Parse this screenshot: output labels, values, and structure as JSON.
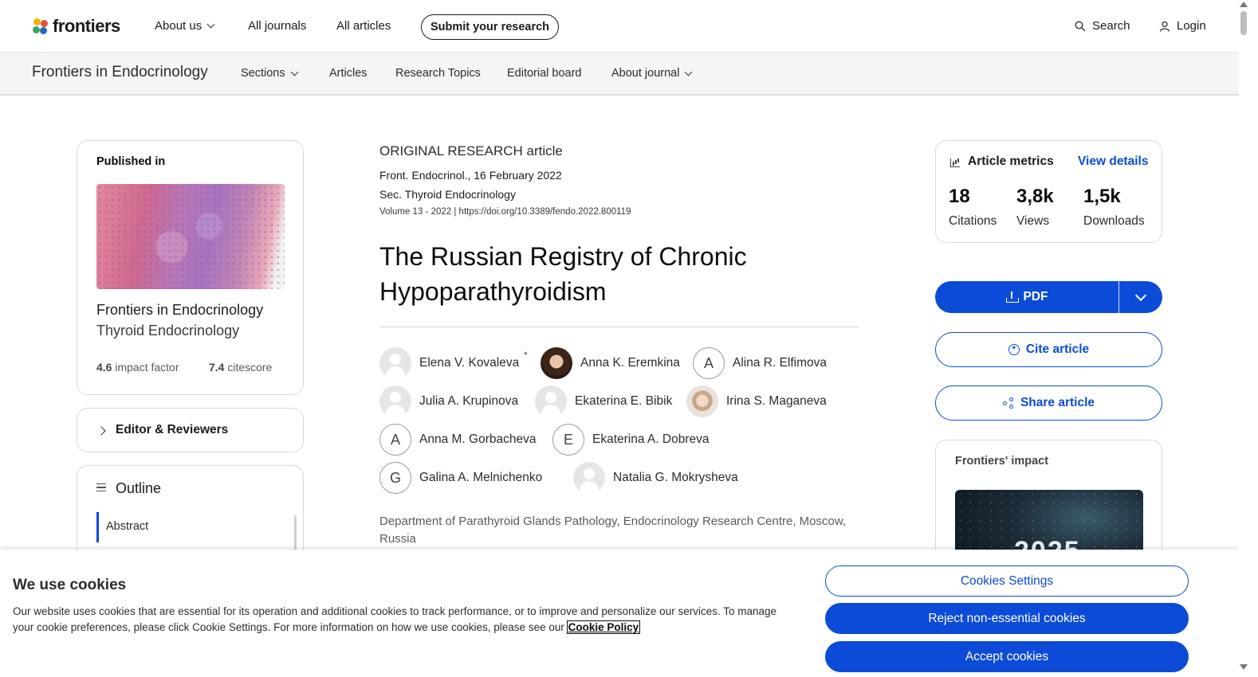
{
  "topnav": {
    "logo_text": "frontiers",
    "about_us": "About us",
    "all_journals": "All journals",
    "all_articles": "All articles",
    "submit": "Submit your research",
    "search": "Search",
    "login": "Login"
  },
  "journal_nav": {
    "title": "Frontiers in Endocrinology",
    "sections": "Sections",
    "articles": "Articles",
    "research_topics": "Research Topics",
    "editorial_board": "Editorial board",
    "about_journal": "About journal"
  },
  "published_in": {
    "label": "Published in",
    "journal": "Frontiers in Endocrinology",
    "section": "Thyroid Endocrinology",
    "impact_value": "4.6",
    "impact_label": "impact factor",
    "citescore_value": "7.4",
    "citescore_label": "citescore"
  },
  "editors": {
    "label": "Editor & Reviewers"
  },
  "outline": {
    "label": "Outline",
    "items": [
      "Abstract"
    ]
  },
  "article": {
    "type": "ORIGINAL RESEARCH article",
    "journal_date": "Front. Endocrinol., 16 February 2022",
    "section": "Sec. Thyroid Endocrinology",
    "volume": "Volume 13 - 2022 |",
    "doi": "https://doi.org/10.3389/fendo.2022.800119",
    "title": "The Russian Registry of Chronic Hypoparathyroidism",
    "authors": [
      {
        "name": "Elena V. Kovaleva",
        "sup": "*",
        "avatar": "ghost"
      },
      {
        "name": "Anna K. Eremkina",
        "avatar": "photo"
      },
      {
        "name": "Alina R. Elfimova",
        "avatar": "letter",
        "letter": "A"
      },
      {
        "name": "Julia A. Krupinova",
        "avatar": "ghost"
      },
      {
        "name": "Ekaterina E. Bibik",
        "avatar": "ghost"
      },
      {
        "name": "Irina S. Maganeva",
        "avatar": "photo"
      },
      {
        "name": "Anna M. Gorbacheva",
        "avatar": "letter",
        "letter": "A"
      },
      {
        "name": "Ekaterina A. Dobreva",
        "avatar": "letter",
        "letter": "E"
      },
      {
        "name": "Galina A. Melnichenko",
        "avatar": "letter",
        "letter": "G"
      },
      {
        "name": "Natalia G. Mokrysheva",
        "avatar": "ghost"
      }
    ],
    "affiliation": "Department of Parathyroid Glands Pathology, Endocrinology Research Centre, Moscow, Russia"
  },
  "metrics": {
    "label": "Article metrics",
    "link": "View details",
    "citations_value": "18",
    "citations_label": "Citations",
    "views_value": "3,8k",
    "views_label": "Views",
    "downloads_value": "1,5k",
    "downloads_label": "Downloads"
  },
  "actions": {
    "pdf": "PDF",
    "cite": "Cite article",
    "share": "Share article"
  },
  "impact": {
    "label": "Frontiers' impact",
    "year": "2025"
  },
  "cookies": {
    "title": "We use cookies",
    "text": "Our website uses cookies that are essential for its operation and additional cookies to track performance, or to improve and personalize our services. To manage your cookie preferences, please click Cookie Settings. For more information on how we use cookies, please see our",
    "policy_link": "Cookie Policy",
    "settings": "Cookies Settings",
    "reject": "Reject non-essential cookies",
    "accept": "Accept cookies"
  },
  "colors": {
    "accent": "#0b4bd8"
  }
}
